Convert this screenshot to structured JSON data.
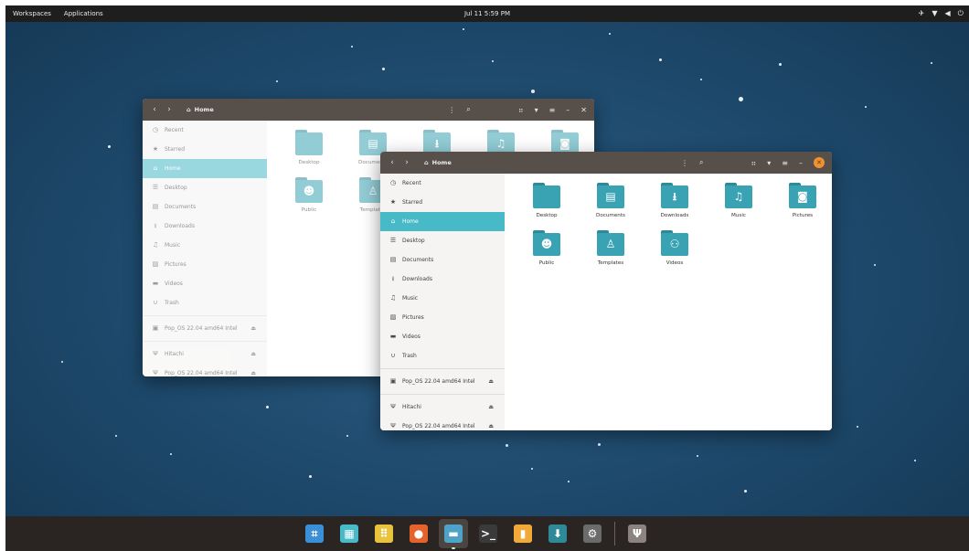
{
  "topbar": {
    "workspaces": "Workspaces",
    "applications": "Applications",
    "clock": "Jul 11  5:59 PM",
    "tray_icons": [
      "notification-icon",
      "wifi-icon",
      "volume-icon",
      "power-icon"
    ]
  },
  "back_window": {
    "path": "Home",
    "sidebar": [
      {
        "label": "Recent",
        "icon": "clock-icon"
      },
      {
        "label": "Starred",
        "icon": "star-icon"
      },
      {
        "label": "Home",
        "icon": "home-icon",
        "active": true
      },
      {
        "label": "Desktop",
        "icon": "desktop-icon"
      },
      {
        "label": "Documents",
        "icon": "document-icon"
      },
      {
        "label": "Downloads",
        "icon": "download-icon"
      },
      {
        "label": "Music",
        "icon": "music-icon"
      },
      {
        "label": "Pictures",
        "icon": "pictures-icon"
      },
      {
        "label": "Videos",
        "icon": "videos-icon"
      },
      {
        "label": "Trash",
        "icon": "trash-icon"
      },
      {
        "label": "Pop_OS 22.04 amd64 Intel",
        "icon": "disk-icon",
        "eject": true
      },
      {
        "label": "Hitachi",
        "icon": "usb-icon",
        "eject": true
      },
      {
        "label": "Pop_OS 22.04 amd64 Intel",
        "icon": "usb-icon",
        "eject": true
      }
    ],
    "files": [
      {
        "label": "Desktop",
        "glyph": ""
      },
      {
        "label": "Documents",
        "glyph": "▤"
      },
      {
        "label": "Downloads",
        "glyph": "⭳"
      },
      {
        "label": "Music",
        "glyph": "♫"
      },
      {
        "label": "Pictures",
        "glyph": "◙"
      },
      {
        "label": "Public",
        "glyph": "☻"
      },
      {
        "label": "Templates",
        "glyph": "♙"
      }
    ]
  },
  "front_window": {
    "path": "Home",
    "sidebar": [
      {
        "label": "Recent",
        "icon": "clock-icon"
      },
      {
        "label": "Starred",
        "icon": "star-icon"
      },
      {
        "label": "Home",
        "icon": "home-icon",
        "active": true
      },
      {
        "label": "Desktop",
        "icon": "desktop-icon"
      },
      {
        "label": "Documents",
        "icon": "document-icon"
      },
      {
        "label": "Downloads",
        "icon": "download-icon"
      },
      {
        "label": "Music",
        "icon": "music-icon"
      },
      {
        "label": "Pictures",
        "icon": "pictures-icon"
      },
      {
        "label": "Videos",
        "icon": "videos-icon"
      },
      {
        "label": "Trash",
        "icon": "trash-icon"
      },
      {
        "label": "Pop_OS 22.04 amd64 Intel",
        "icon": "disk-icon",
        "eject": true
      },
      {
        "label": "Hitachi",
        "icon": "usb-icon",
        "eject": true
      },
      {
        "label": "Pop_OS 22.04 amd64 Intel",
        "icon": "usb-icon",
        "eject": true
      }
    ],
    "files": [
      {
        "label": "Desktop",
        "glyph": ""
      },
      {
        "label": "Documents",
        "glyph": "▤"
      },
      {
        "label": "Downloads",
        "glyph": "⭳"
      },
      {
        "label": "Music",
        "glyph": "♫"
      },
      {
        "label": "Pictures",
        "glyph": "◙"
      },
      {
        "label": "Public",
        "glyph": "☻"
      },
      {
        "label": "Templates",
        "glyph": "♙"
      },
      {
        "label": "Videos",
        "glyph": "⚇"
      }
    ]
  },
  "dock": {
    "items": [
      {
        "name": "workspaces-icon",
        "glyph": "⌗",
        "color": "#3b8fd6"
      },
      {
        "name": "desktop-layout-icon",
        "glyph": "▦",
        "color": "#48b9c7"
      },
      {
        "name": "app-grid-icon",
        "glyph": "⠿",
        "color": "#e9c33b"
      },
      {
        "name": "firefox-icon",
        "glyph": "●",
        "color": "#e5632b"
      },
      {
        "name": "files-icon",
        "glyph": "▬",
        "color": "#4fa3c9",
        "active": true
      },
      {
        "name": "terminal-icon",
        "glyph": ">_",
        "color": "#3a3a3a"
      },
      {
        "name": "notes-icon",
        "glyph": "▮",
        "color": "#f1a93a"
      },
      {
        "name": "pop-shop-icon",
        "glyph": "⬇",
        "color": "#2e8a98"
      },
      {
        "name": "settings-icon",
        "glyph": "⚙",
        "color": "#6b6b6b"
      },
      {
        "name": "usb-drive-icon",
        "glyph": "Ψ",
        "color": "#8a8380"
      }
    ]
  },
  "colors": {
    "accent": "#48b9c7",
    "headerbar": "#574f4a",
    "close_button": "#f29130",
    "folder": "#3aa3b3",
    "desktop_bg": "#1e4a6d"
  }
}
